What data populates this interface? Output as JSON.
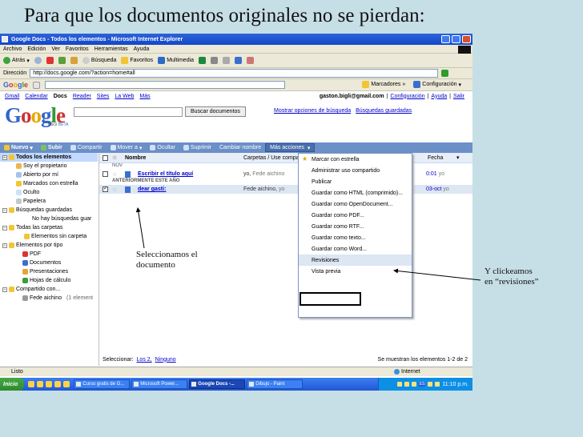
{
  "slide_title": "Para que los documentos originales no se pierdan:",
  "window": {
    "title": "Google Docs - Todos los elementos - Microsoft Internet Explorer"
  },
  "menubar": [
    "Archivo",
    "Edición",
    "Ver",
    "Favoritos",
    "Herramientas",
    "Ayuda"
  ],
  "toolbar": {
    "back": "Atrás",
    "search": "Búsqueda",
    "favorites": "Favoritos",
    "multimedia": "Multimedia"
  },
  "address": {
    "label": "Dirección",
    "url": "http://docs.google.com/?action=home#all"
  },
  "google_toolbar": {
    "bookmarks": "Marcadores",
    "settings": "Configuración"
  },
  "gnav": {
    "links": [
      "Gmail",
      "Calendar",
      "Docs",
      "Reader",
      "Sites",
      "La Web",
      "Más"
    ],
    "current": "Docs",
    "user": "gaston.bigli@gmail.com",
    "user_links": [
      "Configuración",
      "Ayuda",
      "Salir"
    ],
    "sep": "|"
  },
  "search": {
    "logo": "Google",
    "logo_sub": "Docs",
    "logo_beta": "BETA",
    "button": "Buscar documentos",
    "opt_link": "Mostrar opciones de búsqueda",
    "saved_link": "Búsquedas guardadas"
  },
  "docbar": {
    "nuevo": "Nuevo",
    "subir": "Subir",
    "compartir": "Compartir",
    "mover": "Mover a",
    "ocultar": "Ocultar",
    "suprimir": "Suprimir",
    "cambiar": "Cambiar nombre",
    "mas": "Más acciones"
  },
  "left_nav": {
    "todos": "Todos los elementos",
    "items": [
      "Soy el propietario",
      "Abierto por mí",
      "Marcados con estrella",
      "Oculto",
      "Papelera"
    ],
    "saved_header": "Búsquedas guardadas",
    "saved_empty": "No hay búsquedas guar",
    "folders_header": "Todas las carpetas",
    "folders_item": "Elementos sin carpeta",
    "types_header": "Elementos por tipo",
    "types": [
      "PDF",
      "Documentos",
      "Presentaciones",
      "Hojas de cálculo"
    ],
    "shared_header": "Compartido con...",
    "shared_item": "Fede aichino",
    "shared_count": "(1 element"
  },
  "list": {
    "col_name": "Nombre",
    "col_folders": "Carpetas / Use compa",
    "col_date": "Fecha",
    "group_nov": "NOV",
    "group_year": "ANTERIORMENTE ESTE AÑO",
    "rows": [
      {
        "title": "Escribir el título aquí",
        "owner": "yo,",
        "owner2": "Fede aichino",
        "date": "0:01",
        "who": "yo"
      },
      {
        "title": "dear gasti:",
        "owner": "Fede aichino,",
        "owner2": "yo",
        "date": "03-oct",
        "who": "yo"
      }
    ]
  },
  "menu_items": [
    "Marcar con estrella",
    "Administrar uso compartido",
    "Publicar",
    "Guardar como HTML (comprimido)...",
    "Guardar como OpenDocument...",
    "Guardar como PDF...",
    "Guardar como RTF...",
    "Guardar como texto...",
    "Guardar como Word...",
    "Revisiones",
    "Vista previa"
  ],
  "bottombar": {
    "label": "Seleccionar:",
    "link1": "Los 2,",
    "link2": "Ninguno",
    "count": "Se muestran los elementos 1-2 de 2"
  },
  "status": {
    "left": "Listo",
    "zone": "Internet"
  },
  "taskbar": {
    "start": "Inicio",
    "tasks": [
      "Curso gratis de G...",
      "Microsoft Power...",
      "Google Docs -...",
      "Dibujo - Paint"
    ],
    "active_index": 2,
    "lang": "ES",
    "clock": "11:10 p.m."
  },
  "annotations": {
    "select_note": [
      "Seleccionamos el",
      "documento"
    ],
    "click_note": [
      "Y clickeamos",
      "en “revisiones”"
    ]
  },
  "colors": {
    "slide_bg": "#c6dfe6",
    "xp_blue": "#2257d5",
    "docbar": "#6b8fc7",
    "selection": "#c3d9ff",
    "link": "#0000cc"
  }
}
